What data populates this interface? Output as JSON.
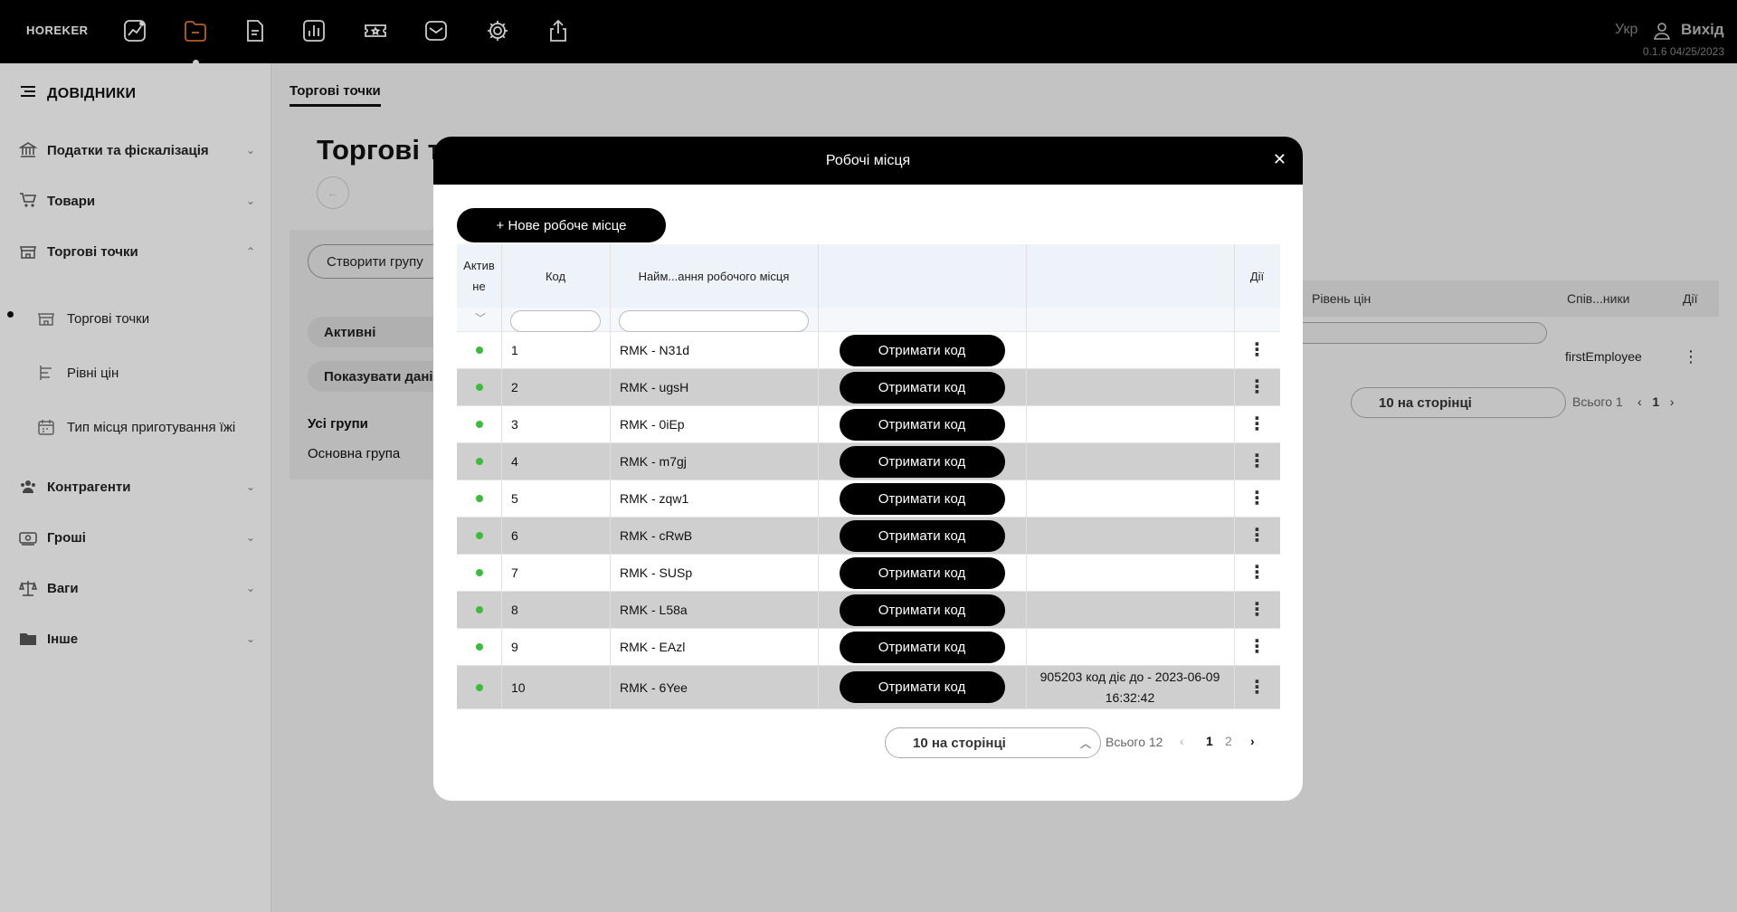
{
  "topbar": {
    "brand": "HOREKER",
    "icons": [
      "chart-line-icon",
      "folder-icon",
      "document-icon",
      "bar-chart-icon",
      "ticket-icon",
      "mail-icon",
      "gear-icon",
      "upload-icon"
    ],
    "lang": "Укр",
    "logout": "Вихід",
    "version": "0.1.6 04/25/2023"
  },
  "sidebar": {
    "title": "ДОВІДНИКИ",
    "items": [
      {
        "label": "Податки та фіскалізація",
        "icon": "bank-icon"
      },
      {
        "label": "Товари",
        "icon": "cart-icon"
      },
      {
        "label": "Торгові точки",
        "icon": "store-icon"
      },
      {
        "label": "Контрагенти",
        "icon": "people-icon"
      },
      {
        "label": "Гроші",
        "icon": "money-icon"
      },
      {
        "label": "Ваги",
        "icon": "scales-icon"
      },
      {
        "label": "Інше",
        "icon": "folder-icon"
      }
    ],
    "subitems": [
      {
        "label": "Торгові точки",
        "icon": "store-icon"
      },
      {
        "label": "Рівні цін",
        "icon": "levels-icon"
      },
      {
        "label": "Тип місця приготування їжі",
        "icon": "calendar-icon"
      }
    ]
  },
  "page": {
    "tab": "Торгові точки",
    "title": "Торгові т",
    "create_group": "Створити групу",
    "active": "Активні",
    "show_data": "Показувати дані",
    "all_groups": "Усі групи",
    "main_group": "Основна група",
    "table_headers": [
      "Рівень цін",
      "Спів...ники",
      "Дії"
    ],
    "row_value": "firstEmployee",
    "per_page": "10 на сторінці",
    "total": "Всього 1",
    "page_num": "1"
  },
  "modal": {
    "title": "Робочі місця",
    "add_button": "+ Нове робоче місце",
    "headers": {
      "active": "Активне",
      "code": "Код",
      "name": "Найм...ання робочого місця",
      "actions": "Дії"
    },
    "get_code_label": "Отримати код",
    "rows": [
      {
        "code": "1",
        "name": "RMK - N31d",
        "note": ""
      },
      {
        "code": "2",
        "name": "RMK - ugsH",
        "note": ""
      },
      {
        "code": "3",
        "name": "RMK - 0iEp",
        "note": ""
      },
      {
        "code": "4",
        "name": "RMK - m7gj",
        "note": ""
      },
      {
        "code": "5",
        "name": "RMK - zqw1",
        "note": ""
      },
      {
        "code": "6",
        "name": "RMK - cRwB",
        "note": ""
      },
      {
        "code": "7",
        "name": "RMK - SUSp",
        "note": ""
      },
      {
        "code": "8",
        "name": "RMK - L58a",
        "note": ""
      },
      {
        "code": "9",
        "name": "RMK - EAzl",
        "note": ""
      },
      {
        "code": "10",
        "name": "RMK - 6Yee",
        "note": "905203 код діє до - 2023-06-09 16:32:42"
      }
    ],
    "pager": {
      "per_page": "10 на сторінці",
      "total": "Всього 12",
      "prev": "‹",
      "page1": "1",
      "page2": "2",
      "next": "›"
    }
  }
}
